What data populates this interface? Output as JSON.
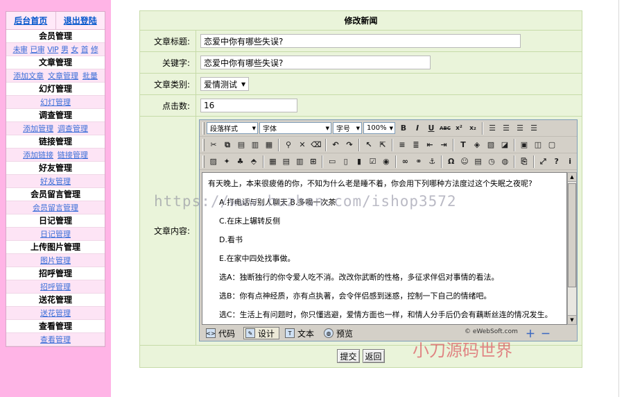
{
  "sidebar": {
    "home_link": "后台首页",
    "logout_link": "退出登陆",
    "groups": [
      {
        "title": "会员管理",
        "links": [
          "未审",
          "已审",
          "VIP",
          "男",
          "女",
          "首",
          "修"
        ]
      },
      {
        "title": "文章管理",
        "links": [
          "添加文章",
          "文章管理",
          "批量"
        ]
      },
      {
        "title": "幻灯管理",
        "links": [
          "幻灯管理"
        ]
      },
      {
        "title": "调查管理",
        "links": [
          "添加管理",
          "调查管理"
        ]
      },
      {
        "title": "链接管理",
        "links": [
          "添加链接",
          "链接管理"
        ]
      },
      {
        "title": "好友管理",
        "links": [
          "好友管理"
        ]
      },
      {
        "title": "会员留言管理",
        "links": [
          "会员留言管理"
        ]
      },
      {
        "title": "日记管理",
        "links": [
          "日记管理"
        ]
      },
      {
        "title": "上传图片管理",
        "links": [
          "图片管理"
        ]
      },
      {
        "title": "招呼管理",
        "links": [
          "招呼管理"
        ]
      },
      {
        "title": "送花管理",
        "links": [
          "送花管理"
        ]
      },
      {
        "title": "查看管理",
        "links": [
          "查看管理"
        ]
      }
    ]
  },
  "form": {
    "heading": "修改新闻",
    "title_label": "文章标题:",
    "title_value": "恋爱中你有哪些失误?",
    "keyword_label": "关键字:",
    "keyword_value": "恋爱中你有哪些失误?",
    "category_label": "文章类别:",
    "category_value": "爱情测试",
    "clicks_label": "点击数:",
    "clicks_value": "16",
    "content_label": "文章内容:",
    "submit_label": "提交",
    "back_label": "返回"
  },
  "editor": {
    "paragraph_style": "段落样式",
    "font": "字体",
    "font_size": "字号",
    "zoom": "100%",
    "content_lines": [
      "有天晚上，本来很疲倦的你，不知为什么老是睡不着，你会用下列哪种方法度过这个失眠之夜呢?",
      "A.打电话与别人聊天 B.多喝一次茶",
      "C.在床上辗转反侧",
      "D.看书",
      "E.在家中四处找事做。",
      "选A：独断独行的你令爱人吃不消。改改你武断的性格，多征求伴侣对事情的看法。",
      "选B：你有点神经质，亦有点执著，会令伴侣感到迷惑，控制一下自己的情绪吧。",
      "选C：生活上有问题时，你只懂逃避，爱情方面也一样，和情人分手后仍会有藕断丝连的情况发生。"
    ],
    "modes": [
      "代码",
      "设计",
      "文本",
      "预览"
    ],
    "active_mode": "设计",
    "credit": "© eWebSoft.com"
  },
  "overlays": {
    "watermark": "https://www.huzhan.com/ishop3572",
    "stamp": "小刀源码世界"
  }
}
